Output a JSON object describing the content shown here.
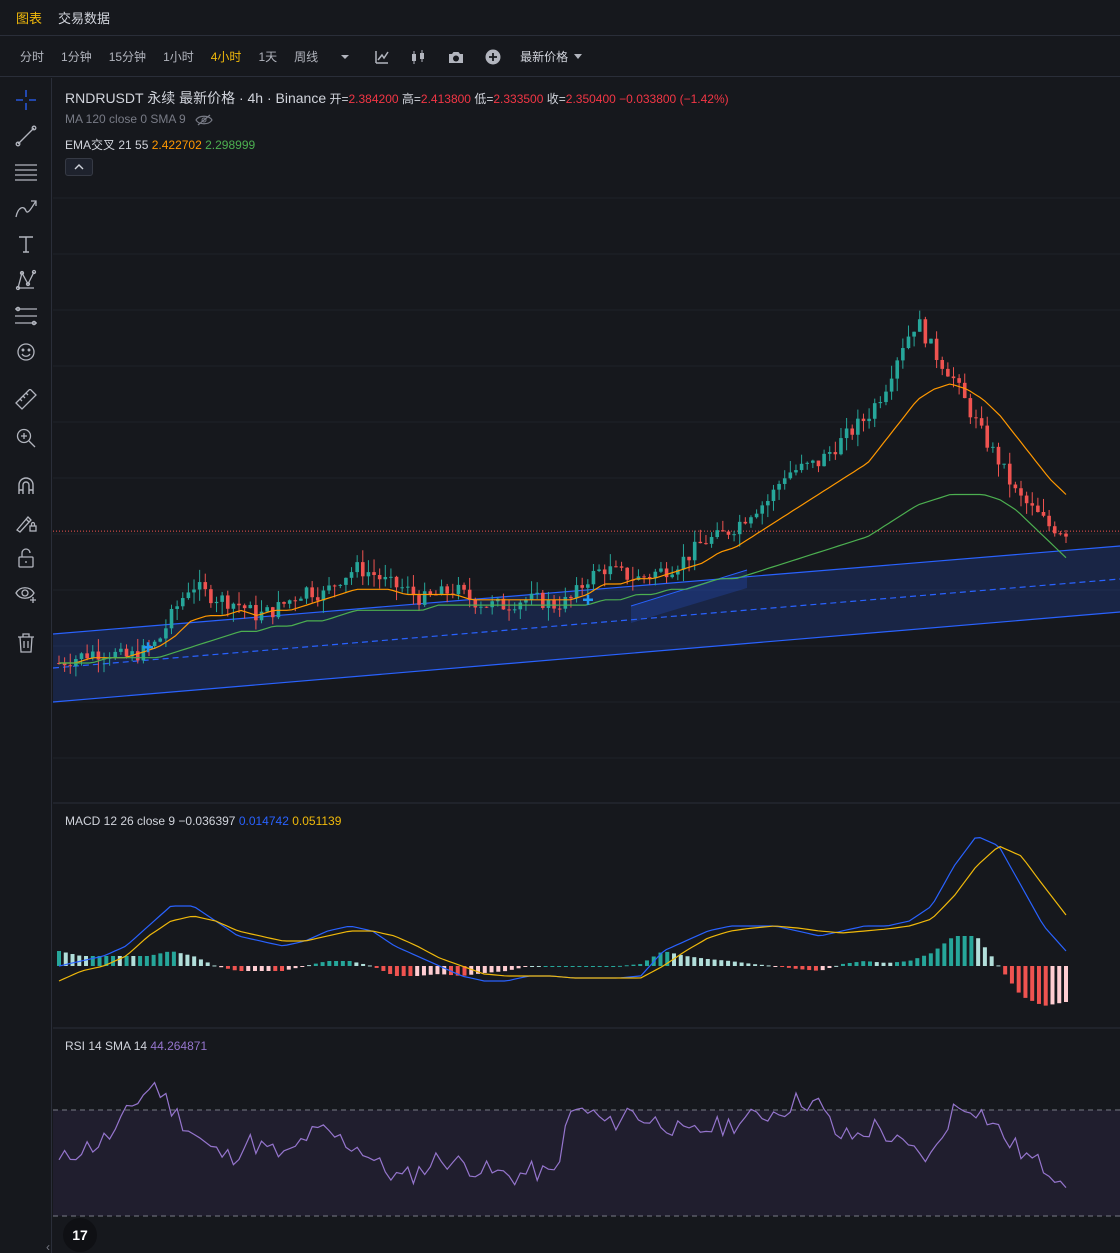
{
  "tabs": [
    "图表",
    "交易数据"
  ],
  "active_tab": 0,
  "toolbar": {
    "timeframes": [
      "分时",
      "1分钟",
      "15分钟",
      "1小时",
      "4小时",
      "1天",
      "周线"
    ],
    "active_timeframe": 4,
    "dropdown_icon": "chevron-down-icon",
    "icons": [
      "indicator-icon",
      "candle-style-icon",
      "camera-icon",
      "add-icon"
    ],
    "price_type": "最新价格"
  },
  "left_tools": [
    "crosshair-icon",
    "trend-line-icon",
    "horizontal-lines-icon",
    "brush-icon",
    "text-icon",
    "pattern-icon",
    "fib-icon",
    "emoji-icon",
    "ruler-icon",
    "zoom-icon",
    "magnet-icon",
    "lock-draw-icon",
    "unlock-icon",
    "eye-icon",
    "trash-icon"
  ],
  "main_legend": {
    "symbol": "RNDRUSDT 永续 最新价格 · 4h · Binance",
    "open_label": "开=",
    "open": "2.384200",
    "high_label": "高=",
    "high": "2.413800",
    "low_label": "低=",
    "low": "2.333500",
    "close_label": "收=",
    "close": "2.350400",
    "change": "−0.033800",
    "change_pct": "(−1.42%)",
    "ma_label": "MA 120 close 0 SMA 9",
    "ema_label": "EMA交叉 21 55",
    "ema_fast": "2.422702",
    "ema_slow": "2.298999"
  },
  "macd_legend": {
    "label": "MACD 12 26 close 9",
    "hist": "−0.036397",
    "macd": "0.014742",
    "signal": "0.051139"
  },
  "rsi_legend": {
    "label": "RSI 14 SMA 14",
    "value": "44.264871"
  },
  "logo_text": "17",
  "colors": {
    "up": "#26a69a",
    "down": "#ef5350",
    "ema_fast": "#ff9800",
    "ema_slow": "#4caf50",
    "macd": "#2962ff",
    "signal": "#f0b90b",
    "rsi": "#9575cd",
    "channel": "#2962ff"
  },
  "chart_data": {
    "type": "candlestick",
    "last_price": 2.3504,
    "price_path": [
      2.1,
      2.11,
      2.12,
      2.12,
      2.11,
      2.12,
      2.14,
      2.2,
      2.25,
      2.23,
      2.22,
      2.21,
      2.19,
      2.2,
      2.22,
      2.24,
      2.23,
      2.26,
      2.28,
      2.27,
      2.25,
      2.24,
      2.22,
      2.23,
      2.24,
      2.22,
      2.21,
      2.21,
      2.22,
      2.22,
      2.21,
      2.22,
      2.26,
      2.28,
      2.27,
      2.26,
      2.27,
      2.28,
      2.3,
      2.33,
      2.34,
      2.36,
      2.39,
      2.41,
      2.46,
      2.47,
      2.48,
      2.51,
      2.54,
      2.57,
      2.62,
      2.7,
      2.75,
      2.69,
      2.65,
      2.59,
      2.53,
      2.48,
      2.42,
      2.39,
      2.36,
      2.35
    ],
    "ema_fast_path": [
      2.1,
      2.1,
      2.11,
      2.11,
      2.11,
      2.12,
      2.13,
      2.15,
      2.18,
      2.19,
      2.19,
      2.2,
      2.19,
      2.2,
      2.2,
      2.21,
      2.22,
      2.23,
      2.24,
      2.24,
      2.24,
      2.23,
      2.23,
      2.23,
      2.23,
      2.22,
      2.22,
      2.22,
      2.22,
      2.22,
      2.22,
      2.22,
      2.23,
      2.25,
      2.25,
      2.26,
      2.26,
      2.27,
      2.28,
      2.29,
      2.31,
      2.32,
      2.34,
      2.36,
      2.38,
      2.4,
      2.42,
      2.44,
      2.46,
      2.48,
      2.52,
      2.56,
      2.6,
      2.62,
      2.63,
      2.62,
      2.6,
      2.57,
      2.53,
      2.49,
      2.45,
      2.42
    ],
    "ema_slow_path": [
      2.1,
      2.1,
      2.1,
      2.11,
      2.11,
      2.11,
      2.11,
      2.12,
      2.13,
      2.14,
      2.15,
      2.16,
      2.16,
      2.17,
      2.17,
      2.18,
      2.18,
      2.19,
      2.2,
      2.2,
      2.2,
      2.2,
      2.2,
      2.21,
      2.21,
      2.21,
      2.21,
      2.21,
      2.21,
      2.21,
      2.21,
      2.21,
      2.21,
      2.22,
      2.22,
      2.23,
      2.23,
      2.24,
      2.24,
      2.25,
      2.26,
      2.26,
      2.27,
      2.28,
      2.29,
      2.3,
      2.31,
      2.32,
      2.33,
      2.34,
      2.36,
      2.38,
      2.4,
      2.41,
      2.42,
      2.42,
      2.42,
      2.41,
      2.39,
      2.36,
      2.33,
      2.3
    ],
    "ylim": [
      1.95,
      2.85
    ],
    "macd_path": [
      0.0,
      0.005,
      0.01,
      0.02,
      0.04,
      0.06,
      0.06,
      0.045,
      0.03,
      0.025,
      0.02,
      0.025,
      0.035,
      0.04,
      0.035,
      0.02,
      0.01,
      0.0,
      -0.01,
      -0.015,
      -0.015,
      -0.01,
      -0.01,
      -0.012,
      -0.012,
      -0.012,
      -0.01,
      0.015,
      0.025,
      0.035,
      0.04,
      0.04,
      0.04,
      0.035,
      0.03,
      0.035,
      0.04,
      0.04,
      0.045,
      0.06,
      0.1,
      0.13,
      0.12,
      0.08,
      0.04,
      0.015
    ],
    "signal_path": [
      -0.015,
      -0.005,
      0.0,
      0.01,
      0.03,
      0.045,
      0.05,
      0.045,
      0.035,
      0.03,
      0.025,
      0.025,
      0.03,
      0.035,
      0.035,
      0.03,
      0.02,
      0.008,
      0.0,
      -0.008,
      -0.01,
      -0.01,
      -0.01,
      -0.012,
      -0.012,
      -0.012,
      -0.012,
      0.0,
      0.015,
      0.028,
      0.035,
      0.038,
      0.04,
      0.038,
      0.035,
      0.033,
      0.035,
      0.037,
      0.04,
      0.047,
      0.07,
      0.1,
      0.12,
      0.11,
      0.08,
      0.051
    ],
    "rsi_path": [
      50,
      55,
      57,
      62,
      73,
      80,
      70,
      62,
      55,
      52,
      58,
      55,
      52,
      60,
      62,
      58,
      55,
      48,
      44,
      47,
      52,
      50,
      48,
      46,
      45,
      47,
      45,
      70,
      69,
      64,
      70,
      66,
      65,
      60,
      63,
      64,
      66,
      68,
      70,
      74,
      72,
      60,
      60,
      64,
      58,
      54,
      52,
      70,
      72,
      66,
      58,
      52,
      48,
      44
    ],
    "rsi_levels": [
      70,
      30
    ]
  }
}
